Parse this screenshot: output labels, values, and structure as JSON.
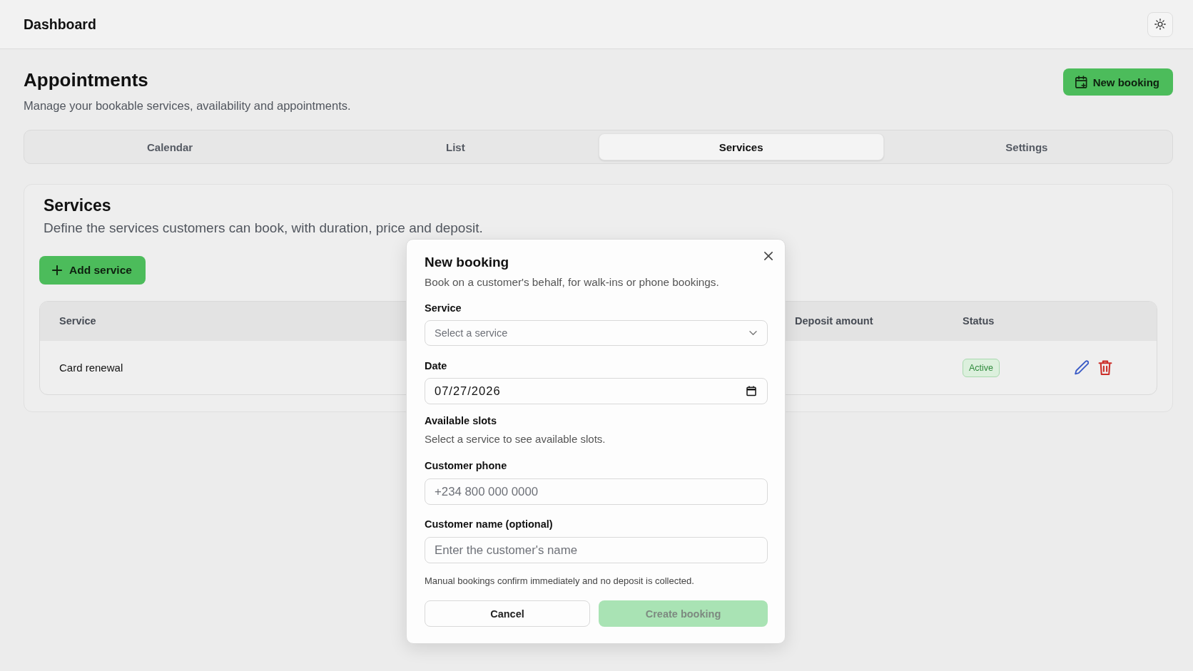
{
  "header": {
    "title": "Dashboard"
  },
  "page": {
    "title": "Appointments",
    "subtitle": "Manage your bookable services, availability and appointments.",
    "primary_action": "New booking"
  },
  "tabs": [
    {
      "label": "Calendar",
      "selected": false
    },
    {
      "label": "List",
      "selected": false
    },
    {
      "label": "Services",
      "selected": true
    },
    {
      "label": "Settings",
      "selected": false
    }
  ],
  "services_panel": {
    "title": "Services",
    "description": "Define the services customers can book, with duration, price and deposit.",
    "add_button": "Add service",
    "table": {
      "columns": [
        {
          "label": "Service"
        },
        {
          "label": "Deposit amount"
        },
        {
          "label": "Status"
        }
      ],
      "rows": [
        {
          "service": "Card renewal",
          "status": "Active"
        }
      ]
    }
  },
  "dialog": {
    "title": "New booking",
    "description": "Book on a customer's behalf, for walk-ins or phone bookings.",
    "fields": [
      {
        "kind": "select",
        "label": "Service",
        "placeholder": "Select a service"
      },
      {
        "kind": "date",
        "label": "Date",
        "value": "07/27/2026"
      },
      {
        "kind": "info",
        "label": "Available slots",
        "message": "Select a service to see available slots."
      },
      {
        "kind": "text",
        "label": "Customer phone",
        "placeholder": "+234 800 000 0000"
      },
      {
        "kind": "text",
        "label": "Customer name (optional)",
        "placeholder": "Enter the customer's name"
      }
    ],
    "note": "Manual bookings confirm immediately and no deposit is collected.",
    "buttons": [
      {
        "kind": "cancel",
        "label": "Cancel",
        "disabled": false
      },
      {
        "kind": "submit",
        "label": "Create booking",
        "disabled": true
      }
    ]
  }
}
